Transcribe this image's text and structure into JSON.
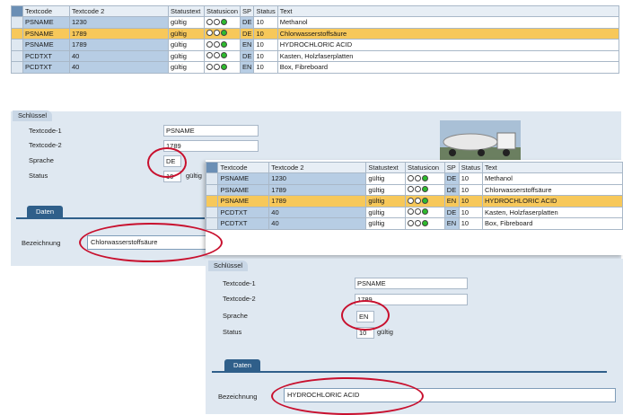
{
  "columns": [
    "Textcode",
    "Textcode 2",
    "Statustext",
    "Statusicon",
    "SP",
    "Status",
    "Text"
  ],
  "table1": {
    "rows": [
      {
        "code": "PSNAME",
        "code2": "1230",
        "statustext": "gültig",
        "lang": "DE",
        "status": "10",
        "text": "Methanol"
      },
      {
        "code": "PSNAME",
        "code2": "1789",
        "statustext": "gültig",
        "lang": "DE",
        "status": "10",
        "text": "Chlorwasserstoffsäure",
        "highlight": true
      },
      {
        "code": "PSNAME",
        "code2": "1789",
        "statustext": "gültig",
        "lang": "EN",
        "status": "10",
        "text": "HYDROCHLORIC ACID"
      },
      {
        "code": "PCDTXT",
        "code2": "40",
        "statustext": "gültig",
        "lang": "DE",
        "status": "10",
        "text": "Kasten, Holzfaserplatten"
      },
      {
        "code": "PCDTXT",
        "code2": "40",
        "statustext": "gültig",
        "lang": "EN",
        "status": "10",
        "text": "Box, Fibreboard"
      }
    ]
  },
  "table2": {
    "rows": [
      {
        "code": "PSNAME",
        "code2": "1230",
        "statustext": "gültig",
        "lang": "DE",
        "status": "10",
        "text": "Methanol"
      },
      {
        "code": "PSNAME",
        "code2": "1789",
        "statustext": "gültig",
        "lang": "DE",
        "status": "10",
        "text": "Chlorwasserstoffsäure"
      },
      {
        "code": "PSNAME",
        "code2": "1789",
        "statustext": "gültig",
        "lang": "EN",
        "status": "10",
        "text": "HYDROCHLORIC ACID",
        "highlight": true
      },
      {
        "code": "PCDTXT",
        "code2": "40",
        "statustext": "gültig",
        "lang": "DE",
        "status": "10",
        "text": "Kasten, Holzfaserplatten"
      },
      {
        "code": "PCDTXT",
        "code2": "40",
        "statustext": "gültig",
        "lang": "EN",
        "status": "10",
        "text": "Box, Fibreboard"
      }
    ]
  },
  "panel1": {
    "group": "Schlüssel",
    "labels": {
      "textcode": "Textcode-1",
      "textcode2": "Textcode-2",
      "sprache": "Sprache",
      "status": "Status"
    },
    "values": {
      "textcode": "PSNAME",
      "textcode2": "1789",
      "sprache": "DE",
      "status": "10",
      "statustext": "gültig"
    },
    "tab": "Daten",
    "bezeichnung_label": "Bezeichnung",
    "bezeichnung_value": "Chlorwasserstoffsäure"
  },
  "panel2": {
    "group": "Schlüssel",
    "labels": {
      "textcode": "Textcode-1",
      "textcode2": "Textcode-2",
      "sprache": "Sprache",
      "status": "Status"
    },
    "values": {
      "textcode": "PSNAME",
      "textcode2": "1789",
      "sprache": "EN",
      "status": "10",
      "statustext": "gültig"
    },
    "tab": "Daten",
    "bezeichnung_label": "Bezeichnung",
    "bezeichnung_value": "HYDROCHLORIC ACID"
  },
  "colors": {
    "highlight": "#f7c85a",
    "key": "#b7cde4",
    "oval": "#c8102e",
    "tab": "#2f5f8a"
  }
}
